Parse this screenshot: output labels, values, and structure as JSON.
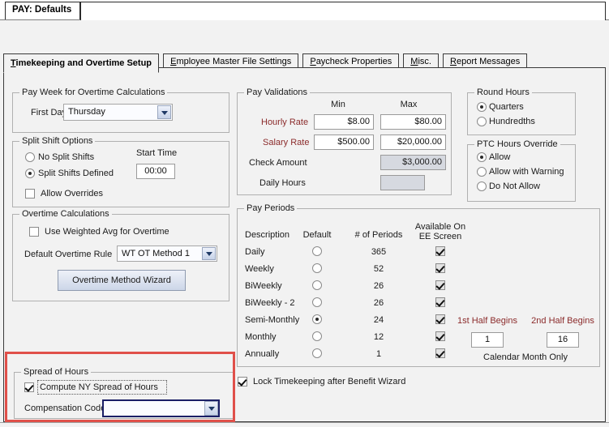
{
  "window": {
    "doc_tab_label": "PAY: Defaults"
  },
  "tabs": [
    {
      "label": "Timekeeping and Overtime Setup",
      "accel": "T",
      "active": true
    },
    {
      "label": "Employee Master File Settings",
      "accel": "E",
      "active": false
    },
    {
      "label": "Paycheck Properties",
      "accel": "P",
      "active": false
    },
    {
      "label": "Misc.",
      "accel": "M",
      "active": false
    },
    {
      "label": "Report Messages",
      "accel": "R",
      "active": false
    }
  ],
  "pay_week": {
    "legend": "Pay Week for Overtime Calculations",
    "first_day_label": "First Day",
    "first_day_value": "Thursday"
  },
  "split_shift": {
    "legend": "Split Shift Options",
    "option_no_split": "No Split Shifts",
    "option_defined": "Split Shifts Defined",
    "selected": "Split Shifts Defined",
    "start_time_label": "Start Time",
    "start_time_value": "00:00",
    "allow_overrides_label": "Allow Overrides",
    "allow_overrides_checked": false
  },
  "overtime_calc": {
    "legend": "Overtime Calculations",
    "weighted_avg_label": "Use Weighted Avg for Overtime",
    "weighted_avg_checked": false,
    "default_rule_label": "Default Overtime Rule",
    "default_rule_value": "WT OT Method 1",
    "wizard_button": "Overtime Method Wizard"
  },
  "pay_validations": {
    "legend": "Pay Validations",
    "col_min": "Min",
    "col_max": "Max",
    "rows": [
      {
        "label": "Hourly Rate",
        "min": "$8.00",
        "max": "$80.00",
        "label_color": "red",
        "min_enabled": true,
        "max_enabled": true
      },
      {
        "label": "Salary Rate",
        "min": "$500.00",
        "max": "$20,000.00",
        "label_color": "red",
        "min_enabled": true,
        "max_enabled": true
      },
      {
        "label": "Check Amount",
        "min": "",
        "max": "$3,000.00",
        "label_color": "dark",
        "min_enabled": false,
        "max_enabled": false
      },
      {
        "label": "Daily Hours",
        "min": "",
        "max": "",
        "label_color": "dark",
        "min_enabled": false,
        "max_enabled": false
      }
    ]
  },
  "round_hours": {
    "legend": "Round Hours",
    "options": [
      "Quarters",
      "Hundredths"
    ],
    "selected": "Quarters"
  },
  "ptc_override": {
    "legend": "PTC Hours Override",
    "options": [
      "Allow",
      "Allow with Warning",
      "Do Not Allow"
    ],
    "selected": "Allow"
  },
  "pay_periods": {
    "legend": "Pay Periods",
    "headers": {
      "description": "Description",
      "default": "Default",
      "num_periods": "# of Periods",
      "available_line1": "Available On",
      "available_line2": "EE Screen"
    },
    "rows": [
      {
        "description": "Daily",
        "default": false,
        "periods": "365",
        "available": true
      },
      {
        "description": "Weekly",
        "default": false,
        "periods": "52",
        "available": true
      },
      {
        "description": "BiWeekly",
        "default": false,
        "periods": "26",
        "available": true
      },
      {
        "description": "BiWeekly - 2",
        "default": false,
        "periods": "26",
        "available": true
      },
      {
        "description": "Semi-Monthly",
        "default": true,
        "periods": "24",
        "available": true
      },
      {
        "description": "Monthly",
        "default": false,
        "periods": "12",
        "available": true
      },
      {
        "description": "Annually",
        "default": false,
        "periods": "1",
        "available": true
      }
    ],
    "first_half_label": "1st Half Begins",
    "first_half_value": "1",
    "second_half_label": "2nd Half Begins",
    "second_half_value": "16",
    "calendar_note": "Calendar Month Only"
  },
  "spread_of_hours": {
    "legend": "Spread of Hours",
    "compute_label": "Compute NY Spread of Hours",
    "compute_checked": true,
    "comp_code_label": "Compensation Code",
    "comp_code_value": ""
  },
  "lock_timekeeping": {
    "label": "Lock Timekeeping after Benefit Wizard",
    "checked": true
  },
  "annotation": {
    "color": "#e0504a"
  }
}
